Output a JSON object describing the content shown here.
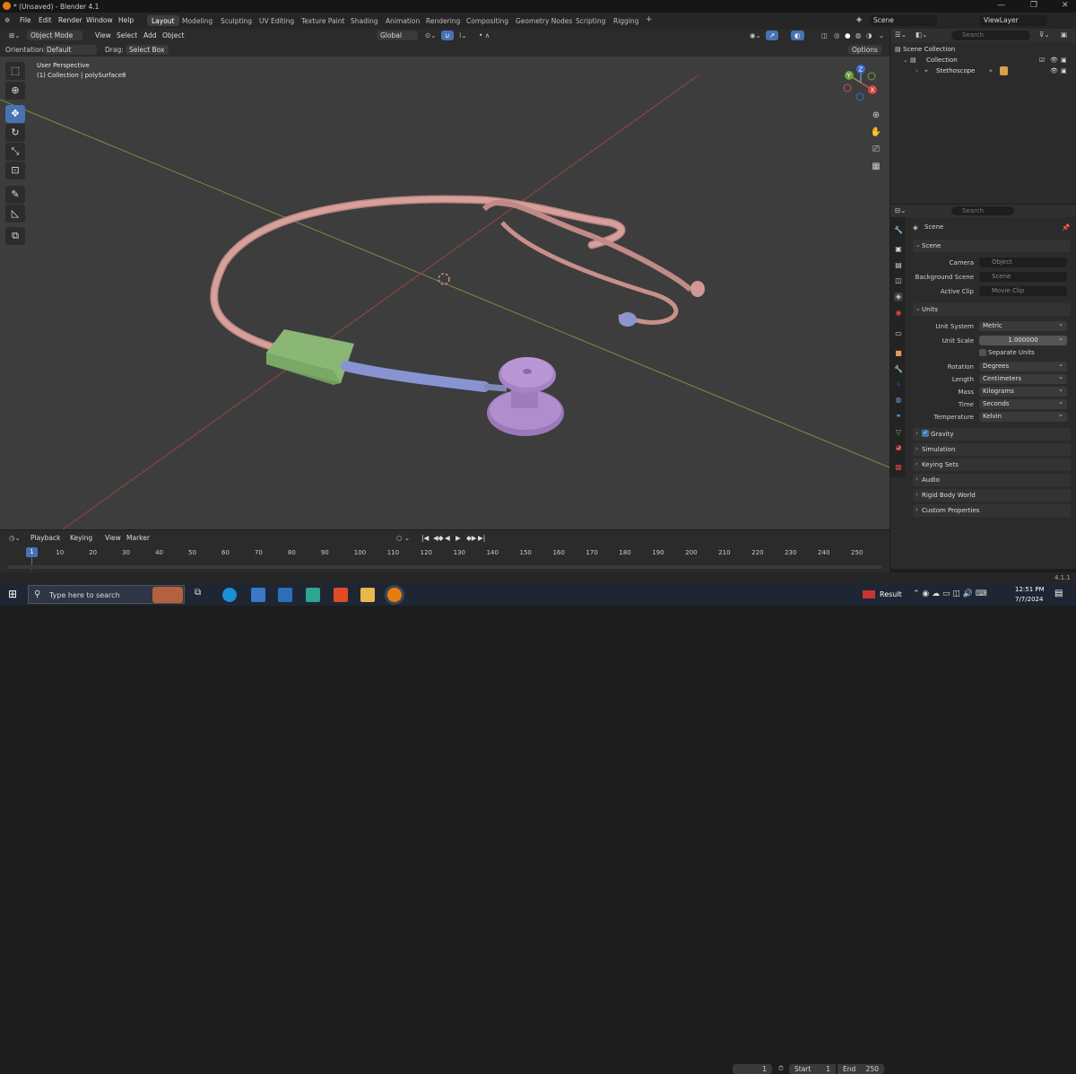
{
  "window": {
    "title": "* (Unsaved) - Blender 4.1",
    "minimize": "—",
    "maximize": "❐",
    "close": "✕"
  },
  "menus": [
    "File",
    "Edit",
    "Render",
    "Window",
    "Help"
  ],
  "workspaces": [
    "Layout",
    "Modeling",
    "Sculpting",
    "UV Editing",
    "Texture Paint",
    "Shading",
    "Animation",
    "Rendering",
    "Compositing",
    "Geometry Nodes",
    "Scripting",
    "Rigging"
  ],
  "workspace_add": "+",
  "scene_name": "Scene",
  "view_layer": "ViewLayer",
  "viewport_header": {
    "mode": "Object Mode",
    "view": "View",
    "select": "Select",
    "add": "Add",
    "object": "Object",
    "transform": "Global",
    "options": "Options"
  },
  "tool_settings": {
    "orientation_label": "Orientation:",
    "orientation": "Default",
    "drag_label": "Drag:",
    "drag": "Select Box"
  },
  "viewport": {
    "perspective": "User Perspective",
    "collection_info": "(1) Collection | polySurface8"
  },
  "outliner": {
    "search_placeholder": "Search",
    "scene_collection": "Scene Collection",
    "collection": "Collection",
    "object": "Stethoscope"
  },
  "properties": {
    "search_placeholder": "Search",
    "context": "Scene",
    "scene_panel": "Scene",
    "camera_label": "Camera",
    "camera_placeholder": "Object",
    "bgscene_label": "Background Scene",
    "bgscene_placeholder": "Scene",
    "clip_label": "Active Clip",
    "clip_placeholder": "Movie Clip",
    "units_panel": "Units",
    "unit_system_label": "Unit System",
    "unit_system": "Metric",
    "unit_scale_label": "Unit Scale",
    "unit_scale": "1.000000",
    "separate_units": "Separate Units",
    "rotation_label": "Rotation",
    "rotation": "Degrees",
    "length_label": "Length",
    "length": "Centimeters",
    "mass_label": "Mass",
    "mass": "Kilograms",
    "time_label": "Time",
    "time": "Seconds",
    "temperature_label": "Temperature",
    "temperature": "Kelvin",
    "collapsed_panels": [
      "Gravity",
      "Simulation",
      "Keying Sets",
      "Audio",
      "Rigid Body World",
      "Custom Properties"
    ]
  },
  "timeline": {
    "playback": "Playback",
    "keying": "Keying",
    "view": "View",
    "marker": "Marker",
    "current_frame": "1",
    "start_label": "Start",
    "start": "1",
    "end_label": "End",
    "end": "250",
    "ticks": [
      "10",
      "20",
      "30",
      "40",
      "50",
      "60",
      "70",
      "80",
      "90",
      "100",
      "110",
      "120",
      "130",
      "140",
      "150",
      "160",
      "170",
      "180",
      "190",
      "200",
      "210",
      "220",
      "230",
      "240",
      "250"
    ]
  },
  "version": "4.1.1",
  "taskbar": {
    "search_placeholder": "Type here to search",
    "weather": "Result",
    "time": "12:51 PM",
    "date": "7/7/2024"
  },
  "colors": {
    "accent": "#4772b3",
    "tube": "#d29a96",
    "chestpiece": "#a987c7",
    "block": "#7faa6a",
    "stem": "#8e9bd8"
  }
}
